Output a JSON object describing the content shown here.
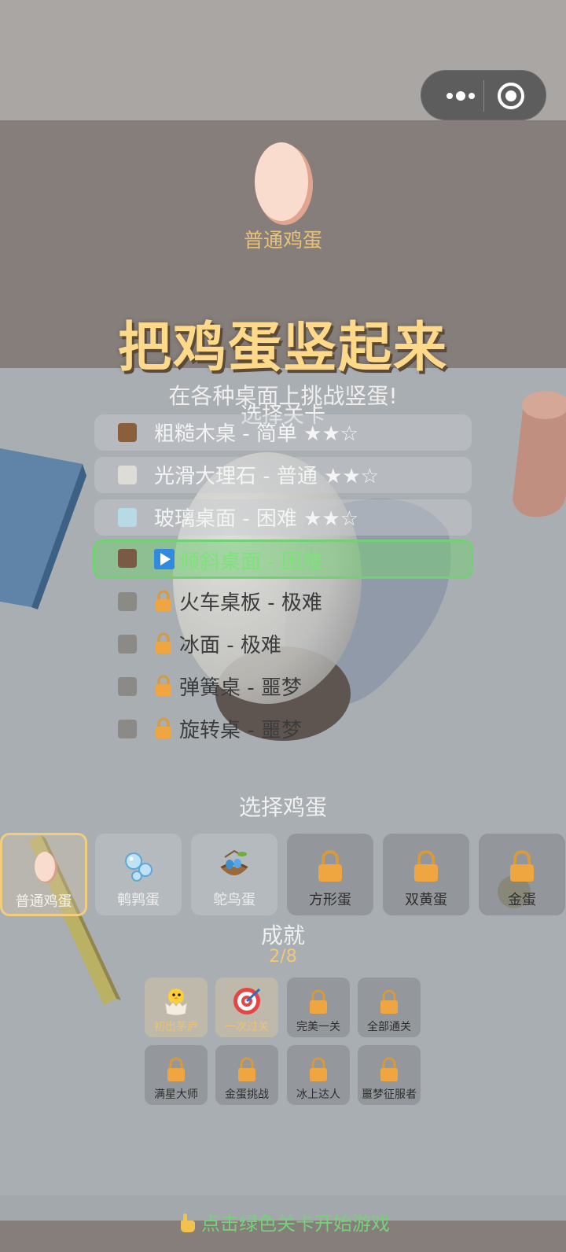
{
  "header": {
    "current_egg": "普通鸡蛋",
    "title": "把鸡蛋竖起来",
    "subtitle": "在各种桌面上挑战竖蛋!"
  },
  "capsule": {
    "more_icon": "more-dots-icon",
    "close_icon": "target-close-icon"
  },
  "levels": {
    "heading": "选择关卡",
    "items": [
      {
        "label": "粗糙木桌 - 简单 ★★☆",
        "color": "#8b5e3c",
        "state": "unlocked"
      },
      {
        "label": "光滑大理石 - 普通 ★★☆",
        "color": "#dedcd6",
        "state": "unlocked"
      },
      {
        "label": "玻璃桌面 - 困难 ★★☆",
        "color": "#b6dbe6",
        "state": "unlocked"
      },
      {
        "label": "倾斜桌面 - 困难",
        "color": "#7a5a45",
        "state": "current"
      },
      {
        "label": "火车桌板 - 极难",
        "color": "#8c8a86",
        "state": "locked"
      },
      {
        "label": "冰面 - 极难",
        "color": "#8c8a86",
        "state": "locked"
      },
      {
        "label": "弹簧桌 - 噩梦",
        "color": "#8c8a86",
        "state": "locked"
      },
      {
        "label": "旋转桌 - 噩梦",
        "color": "#8c8a86",
        "state": "locked"
      }
    ]
  },
  "eggs": {
    "heading": "选择鸡蛋",
    "items": [
      {
        "label": "普通鸡蛋",
        "icon": "egg-icon",
        "state": "selected"
      },
      {
        "label": "鹌鹑蛋",
        "icon": "bubbles-icon",
        "state": "open"
      },
      {
        "label": "鸵鸟蛋",
        "icon": "nest-icon",
        "state": "open"
      },
      {
        "label": "方形蛋",
        "icon": "lock-icon",
        "state": "locked"
      },
      {
        "label": "双黄蛋",
        "icon": "lock-icon",
        "state": "locked"
      },
      {
        "label": "金蛋",
        "icon": "lock-icon",
        "state": "locked"
      }
    ]
  },
  "achievements": {
    "heading": "成就",
    "count": "2/8",
    "items": [
      {
        "label": "初出茅庐",
        "icon": "hatching-chick-icon",
        "state": "earned"
      },
      {
        "label": "一次过关",
        "icon": "bullseye-icon",
        "state": "earned"
      },
      {
        "label": "完美一关",
        "icon": "lock-icon",
        "state": "locked"
      },
      {
        "label": "全部通关",
        "icon": "lock-icon",
        "state": "locked"
      },
      {
        "label": "满星大师",
        "icon": "lock-icon",
        "state": "locked"
      },
      {
        "label": "金蛋挑战",
        "icon": "lock-icon",
        "state": "locked"
      },
      {
        "label": "冰上达人",
        "icon": "lock-icon",
        "state": "locked"
      },
      {
        "label": "噩梦征服者",
        "icon": "lock-icon",
        "state": "locked"
      }
    ]
  },
  "footer": {
    "hint": "点击绿色关卡开始游戏",
    "icon": "pointing-hand-icon"
  },
  "colors": {
    "accent_gold": "#ffd98a",
    "current_green": "#74d076",
    "lock_orange": "#f0a640"
  }
}
